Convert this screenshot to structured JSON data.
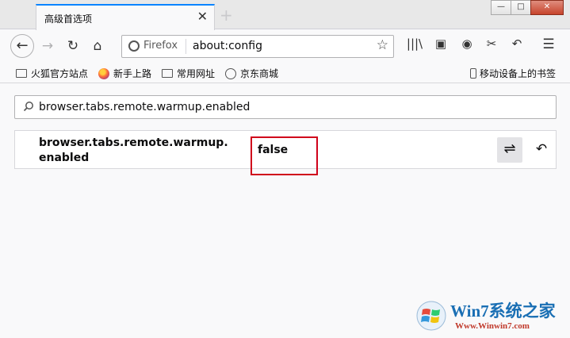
{
  "window": {
    "tab_title": "高级首选项",
    "tab_close": "✕",
    "new_tab": "+",
    "minimize": "—",
    "maximize": "□",
    "close": "✕"
  },
  "navbar": {
    "back_icon": "←",
    "forward_icon": "→",
    "reload_icon": "↻",
    "home_icon": "⌂",
    "identity_label": "Firefox",
    "url": "about:config",
    "star_icon": "☆",
    "library_icon": "|||\\",
    "sidebar_icon": "▣",
    "account_icon": "◉",
    "screenshot_icon": "✂",
    "share_icon": "↶",
    "menu_icon": "☰"
  },
  "bookmarks": {
    "items": [
      {
        "label": "火狐官方站点",
        "icon": "folder-icon"
      },
      {
        "label": "新手上路",
        "icon": "firefox-icon"
      },
      {
        "label": "常用网址",
        "icon": "folder-icon"
      },
      {
        "label": "京东商城",
        "icon": "globe-icon"
      }
    ],
    "mobile": "移动设备上的书签"
  },
  "config": {
    "search_value": "browser.tabs.remote.warmup.enabled",
    "pref_name": "browser.tabs.remote.warmup.\nenabled",
    "pref_value": "false",
    "toggle_icon": "⇌",
    "reset_icon": "↶"
  },
  "watermark": {
    "title": "Win7系统之家",
    "url": "Www.Winwin7.com"
  },
  "colors": {
    "accent": "#0a84ff",
    "highlight": "#d0021b"
  }
}
